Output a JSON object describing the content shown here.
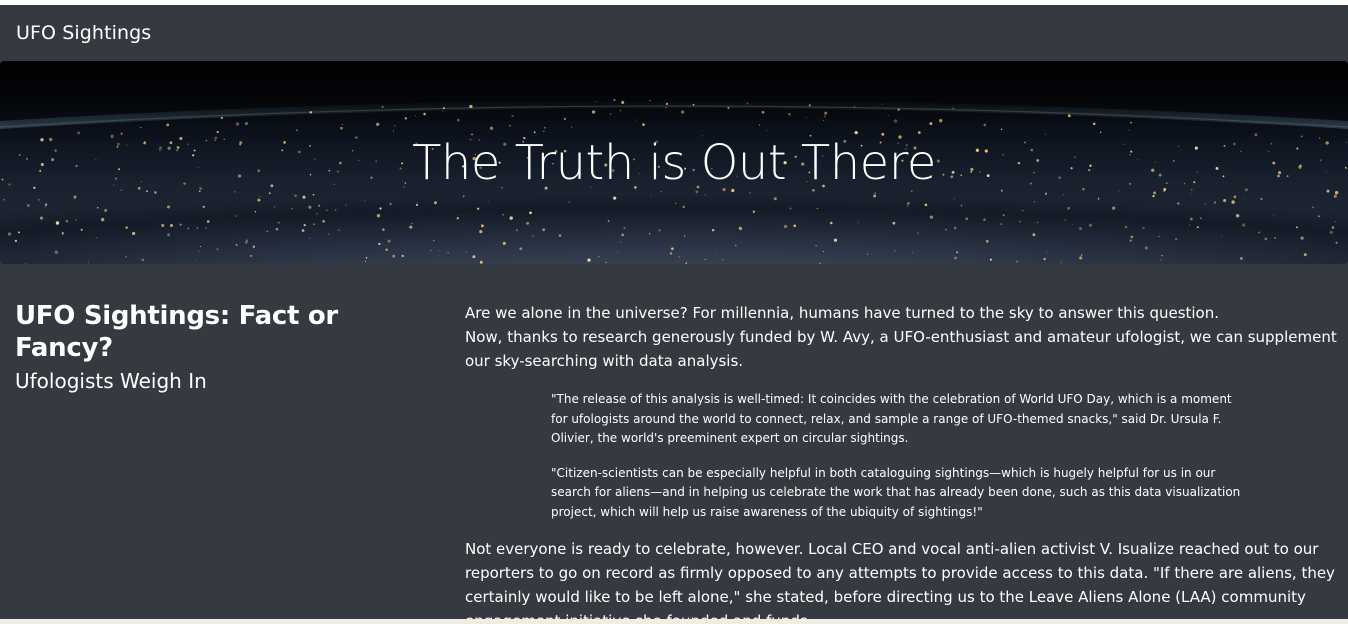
{
  "navbar": {
    "brand": "UFO Sightings"
  },
  "hero": {
    "title": "The Truth is Out There"
  },
  "article": {
    "heading": "UFO Sightings: Fact or Fancy?",
    "subheading": "Ufologists Weigh In",
    "intro_line1": "Are we alone in the universe? For millennia, humans have turned to the sky to answer this question.",
    "intro_line2": "Now, thanks to research generously funded by W. Avy, a UFO-enthusiast and amateur ufologist, we can supplement our sky-searching with data analysis.",
    "quote1": "\"The release of this analysis is well-timed: It coincides with the celebration of World UFO Day, which is a moment for ufologists around the world to connect, relax, and sample a range of UFO-themed snacks,\" said Dr. Ursula F. Olivier, the world's preeminent expert on circular sightings.",
    "quote2": "\"Citizen-scientists can be especially helpful in both cataloguing sightings—which is hugely helpful for us in our search for aliens—and in helping us celebrate the work that has already been done, such as this data visualization project, which will help us raise awareness of the ubiquity of sightings!\"",
    "paragraph2": "Not everyone is ready to celebrate, however. Local CEO and vocal anti-alien activist V. Isualize reached out to our reporters to go on record as firmly opposed to any attempts to provide access to this data. \"If there are aliens, they certainly would like to be left alone,\" she stated, before directing us to the Leave Aliens Alone (LAA) community engagement initiative she founded and funds."
  },
  "colors": {
    "background": "#343a40",
    "text": "#ffffff"
  }
}
